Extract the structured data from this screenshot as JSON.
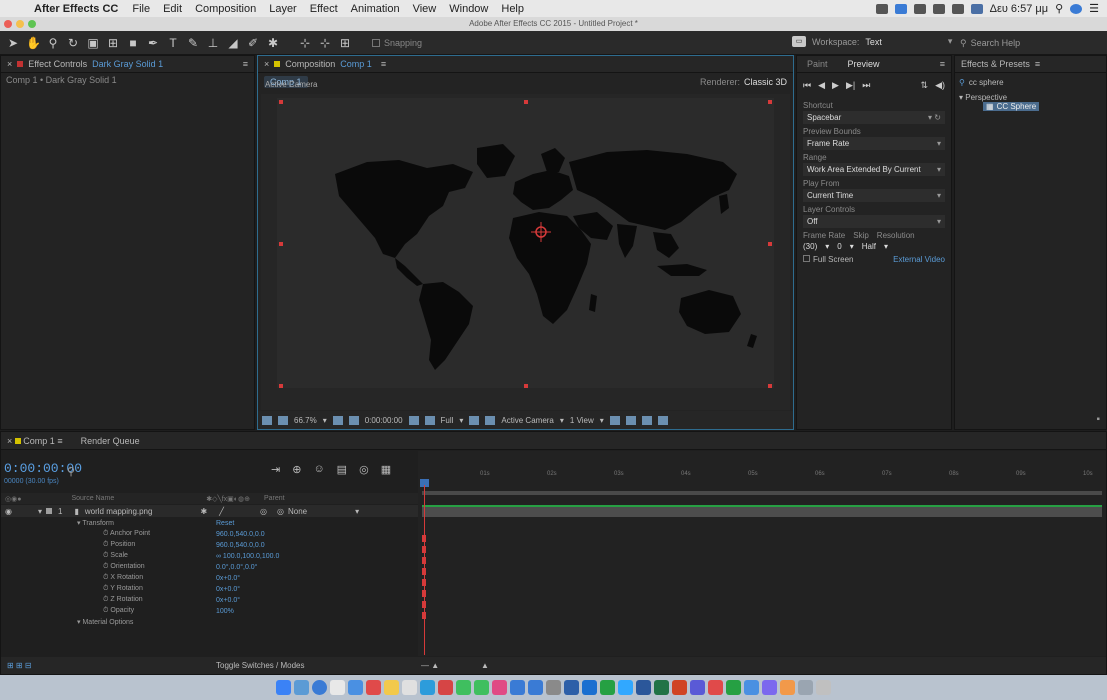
{
  "menubar": {
    "app": "After Effects CC",
    "items": [
      "File",
      "Edit",
      "Composition",
      "Layer",
      "Effect",
      "Animation",
      "View",
      "Window",
      "Help"
    ],
    "clock": "Δευ 6:57 μμ"
  },
  "window_title": "Adobe After Effects CC 2015 - Untitled Project *",
  "toolbar": {
    "snapping": "Snapping",
    "workspace_label": "Workspace:",
    "workspace_value": "Text",
    "search_help": "Search Help"
  },
  "effect_controls": {
    "tab_label": "Effect Controls",
    "tab_target": "Dark Gray Solid 1",
    "breadcrumb": "Comp 1 • Dark Gray Solid 1"
  },
  "composition": {
    "tab_label": "Composition",
    "tab_target": "Comp 1",
    "chip": "Comp 1",
    "renderer_label": "Renderer:",
    "renderer_value": "Classic 3D",
    "active_camera": "Active Camera",
    "footer": {
      "zoom": "66.7%",
      "timecode": "0:00:00:00",
      "quality": "Full",
      "camera": "Active Camera",
      "views": "1 View"
    }
  },
  "preview": {
    "tabs": [
      "Paint",
      "Preview"
    ],
    "shortcut_label": "Shortcut",
    "shortcut_value": "Spacebar",
    "preview_bounds_label": "Preview Bounds",
    "preview_bounds_value": "Frame Rate",
    "range_label": "Range",
    "range_value": "Work Area Extended By Current",
    "play_from_label": "Play From",
    "play_from_value": "Current Time",
    "layer_controls_label": "Layer Controls",
    "layer_controls_value": "Off",
    "mini_labels": [
      "Frame Rate",
      "Skip",
      "Resolution"
    ],
    "mini_values": [
      "(30)",
      "0",
      "Half"
    ],
    "full_screen": "Full Screen",
    "external_video": "External Video"
  },
  "effects_presets": {
    "tab_label": "Effects & Presets",
    "search_value": "cc sphere",
    "category": "Perspective",
    "result": "CC Sphere"
  },
  "timeline": {
    "tabs": [
      "Comp 1",
      "Render Queue"
    ],
    "timecode": "0:00:00:00",
    "timecode_sub": "00000 (30.00 fps)",
    "col_source": "Source Name",
    "col_parent": "Parent",
    "layer": {
      "index": "1",
      "name": "world mapping.png",
      "parent": "None"
    },
    "group_transform": "Transform",
    "reset": "Reset",
    "properties": [
      {
        "name": "Anchor Point",
        "value": "960.0,540.0,0.0"
      },
      {
        "name": "Position",
        "value": "960.0,540.0,0.0"
      },
      {
        "name": "Scale",
        "value": "∞ 100.0,100.0,100.0"
      },
      {
        "name": "Orientation",
        "value": "0.0°,0.0°,0.0°"
      },
      {
        "name": "X Rotation",
        "value": "0x+0.0°"
      },
      {
        "name": "Y Rotation",
        "value": "0x+0.0°"
      },
      {
        "name": "Z Rotation",
        "value": "0x+0.0°"
      },
      {
        "name": "Opacity",
        "value": "100%"
      }
    ],
    "group_material": "Material Options",
    "footer_toggle": "Toggle Switches / Modes",
    "ruler_ticks": [
      "01s",
      "02s",
      "03s",
      "04s",
      "05s",
      "06s",
      "07s",
      "08s",
      "09s",
      "10s"
    ]
  },
  "colors": {
    "accent_blue": "#5a9bd6",
    "handle_red": "#d63a3a",
    "layer_green": "#26a043",
    "label_yellow": "#d4c200"
  }
}
